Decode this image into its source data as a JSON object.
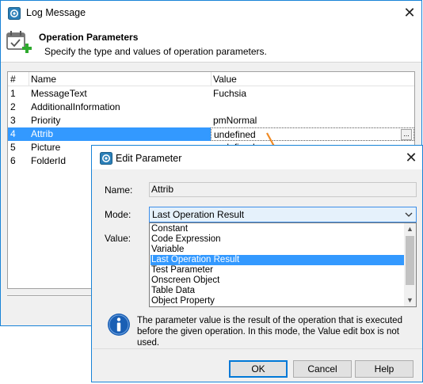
{
  "main_window": {
    "title": "Log Message",
    "header_title": "Operation Parameters",
    "header_subtitle": "Specify the type and values of operation parameters.",
    "columns": [
      "#",
      "Name",
      "Value"
    ],
    "rows": [
      {
        "num": "1",
        "name": "MessageText",
        "value": "Fuchsia"
      },
      {
        "num": "2",
        "name": "AdditionalInformation",
        "value": ""
      },
      {
        "num": "3",
        "name": "Priority",
        "value": "pmNormal"
      },
      {
        "num": "4",
        "name": "Attrib",
        "value": "undefined"
      },
      {
        "num": "5",
        "name": "Picture",
        "value": "undefined"
      },
      {
        "num": "6",
        "name": "FolderId",
        "value": ""
      }
    ],
    "selected_row": 3,
    "ellipsis_label": "..."
  },
  "dialog": {
    "title": "Edit Parameter",
    "name_label": "Name:",
    "name_value": "Attrib",
    "mode_label": "Mode:",
    "mode_value": "Last Operation Result",
    "value_label": "Value:",
    "options": [
      "Constant",
      "Code Expression",
      "Variable",
      "Last Operation Result",
      "Test Parameter",
      "Onscreen Object",
      "Table Data",
      "Object Property"
    ],
    "selected_option": 3,
    "info_text": "The parameter value is the result of the operation that is executed before the given operation. In this mode, the Value edit box is not used.",
    "buttons": {
      "ok": "OK",
      "cancel": "Cancel",
      "help": "Help"
    }
  },
  "colors": {
    "accent": "#1883d7",
    "selection": "#3399ff",
    "arrow": "#f08a24",
    "info_icon": "#1a5fb4"
  },
  "icons": {
    "app": "app-gear-icon",
    "header": "calendar-add-icon",
    "info": "info-icon",
    "close": "close-icon",
    "combo": "chevron-down-icon",
    "pointer": "orange-arrow-icon"
  }
}
